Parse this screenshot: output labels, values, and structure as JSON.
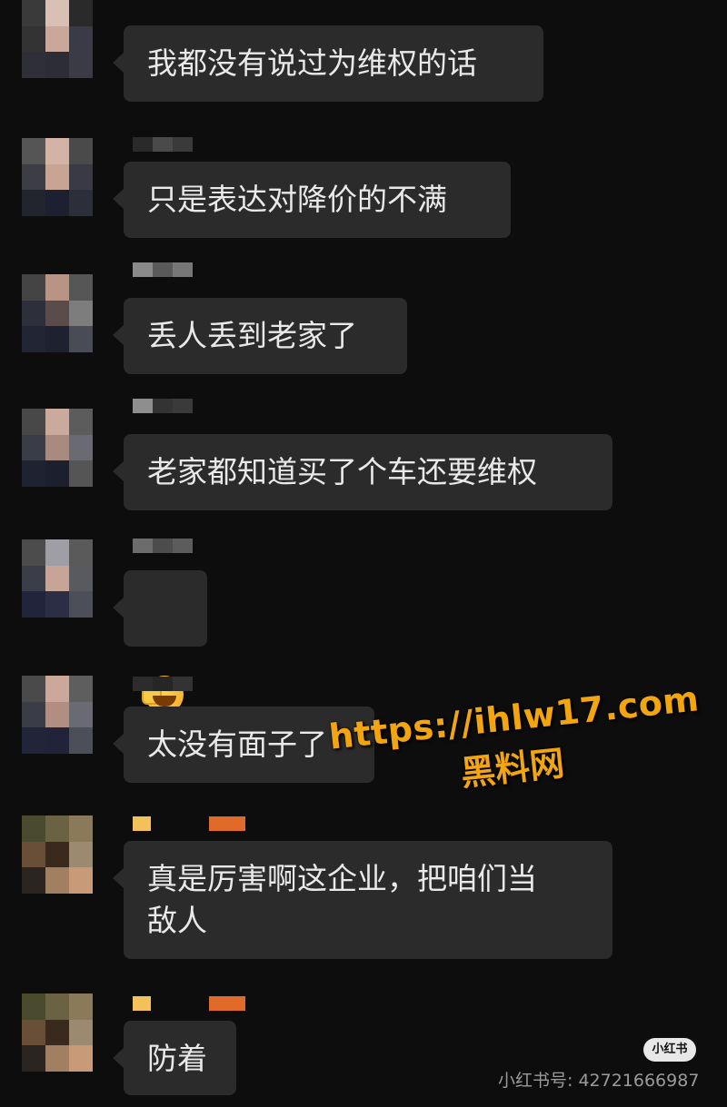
{
  "messages": [
    {
      "text": "我都没有说过为维权的话"
    },
    {
      "text": "只是表达对降价的不满"
    },
    {
      "text": "丢人丢到老家了"
    },
    {
      "text": "老家都知道买了个车还要维权"
    },
    {
      "text": "",
      "emoji": "facepalm-laughing-emoji"
    },
    {
      "text": "太没有面子了"
    },
    {
      "text": "真是厉害啊这企业，把咱们当\n敌人"
    },
    {
      "text": "防着"
    }
  ],
  "watermark": {
    "url": "https://ihlw17.com",
    "name": "黑料网"
  },
  "xiaohongshu": {
    "logo": "小红书",
    "id": "小红书号: 42721666987"
  }
}
